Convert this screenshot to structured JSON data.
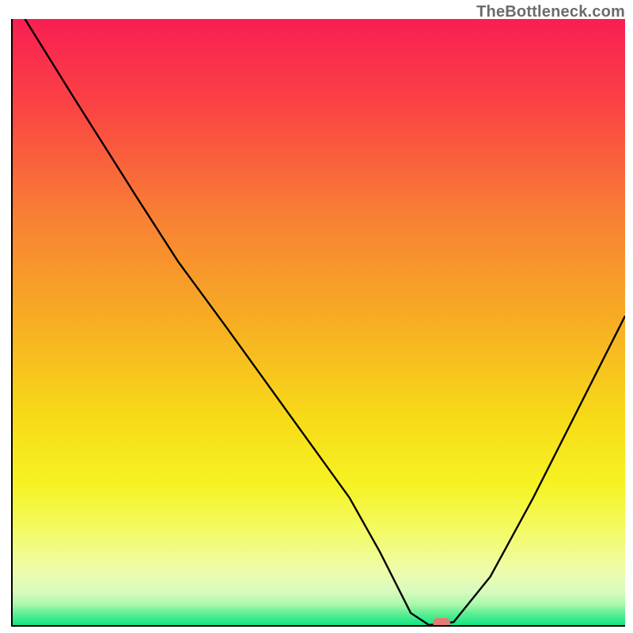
{
  "watermark": "TheBottleneck.com",
  "chart_data": {
    "type": "line",
    "title": "",
    "xlabel": "",
    "ylabel": "",
    "xlim": [
      0,
      100
    ],
    "ylim": [
      0,
      100
    ],
    "x": [
      2,
      10,
      20,
      27,
      35,
      45,
      55,
      60,
      63,
      65,
      68,
      72,
      78,
      85,
      92,
      100
    ],
    "values": [
      100,
      87,
      71,
      60,
      49,
      35,
      21,
      12,
      6,
      2,
      0,
      0.5,
      8,
      21,
      35,
      51
    ],
    "marker": {
      "x": 70,
      "y": 0
    },
    "gradient_stops": [
      {
        "pct": 0,
        "color": "#f81f52"
      },
      {
        "pct": 14,
        "color": "#fb4244"
      },
      {
        "pct": 32,
        "color": "#f87e35"
      },
      {
        "pct": 50,
        "color": "#f7ae23"
      },
      {
        "pct": 66,
        "color": "#f7db18"
      },
      {
        "pct": 77,
        "color": "#f6f323"
      },
      {
        "pct": 85,
        "color": "#f3fb6b"
      },
      {
        "pct": 91,
        "color": "#eefcab"
      },
      {
        "pct": 94.5,
        "color": "#d7fbbe"
      },
      {
        "pct": 96.5,
        "color": "#aef8ac"
      },
      {
        "pct": 98,
        "color": "#62ef94"
      },
      {
        "pct": 100,
        "color": "#11e684"
      }
    ]
  }
}
